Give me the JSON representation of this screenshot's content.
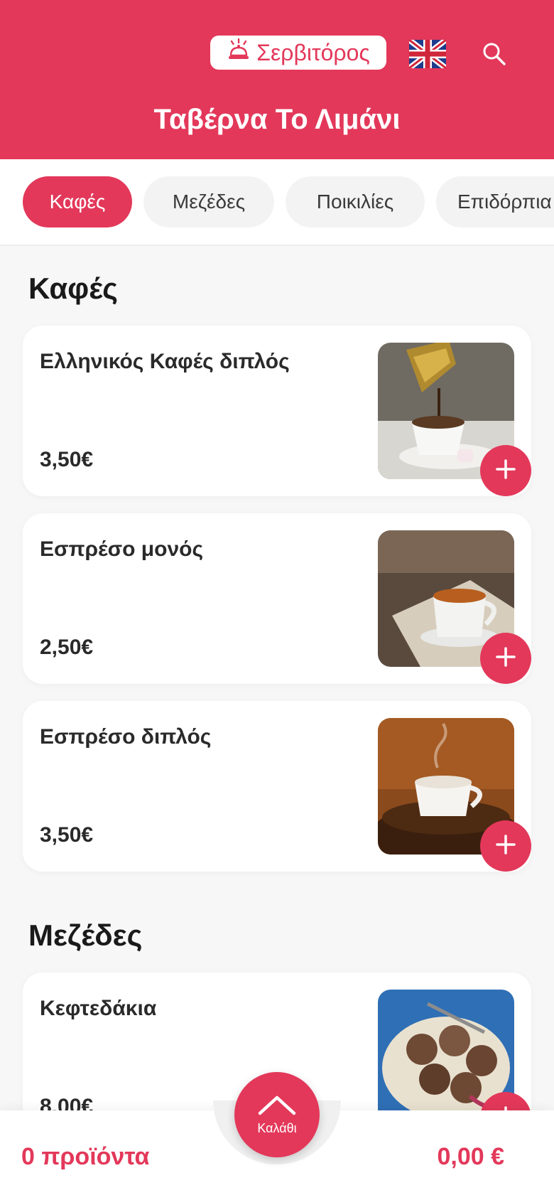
{
  "header": {
    "waiter_label": "Σερβιτόρος",
    "title": "Ταβέρνα Το Λιμάνι",
    "icons": {
      "waiter": "bell-icon",
      "language": "uk-flag-icon",
      "search": "search-icon"
    }
  },
  "tabs": [
    {
      "label": "Καφές",
      "active": true
    },
    {
      "label": "Μεζέδες",
      "active": false
    },
    {
      "label": "Ποικιλίες",
      "active": false
    },
    {
      "label": "Επιδόρπια",
      "active": false
    }
  ],
  "sections": [
    {
      "title": "Καφές",
      "items": [
        {
          "name": "Ελληνικός Καφές διπλός",
          "price": "3,50€"
        },
        {
          "name": "Εσπρέσο μονός",
          "price": "2,50€"
        },
        {
          "name": "Εσπρέσο διπλός",
          "price": "3,50€"
        }
      ]
    },
    {
      "title": "Μεζέδες",
      "items": [
        {
          "name": "Κεφτεδάκια",
          "price": "8,00€"
        }
      ]
    }
  ],
  "cart": {
    "count_label": "0 προϊόντα",
    "button_label": "Καλάθι",
    "total": "0,00 €"
  },
  "colors": {
    "accent": "#e3385a",
    "background": "#f7f7f7",
    "card": "#ffffff"
  }
}
